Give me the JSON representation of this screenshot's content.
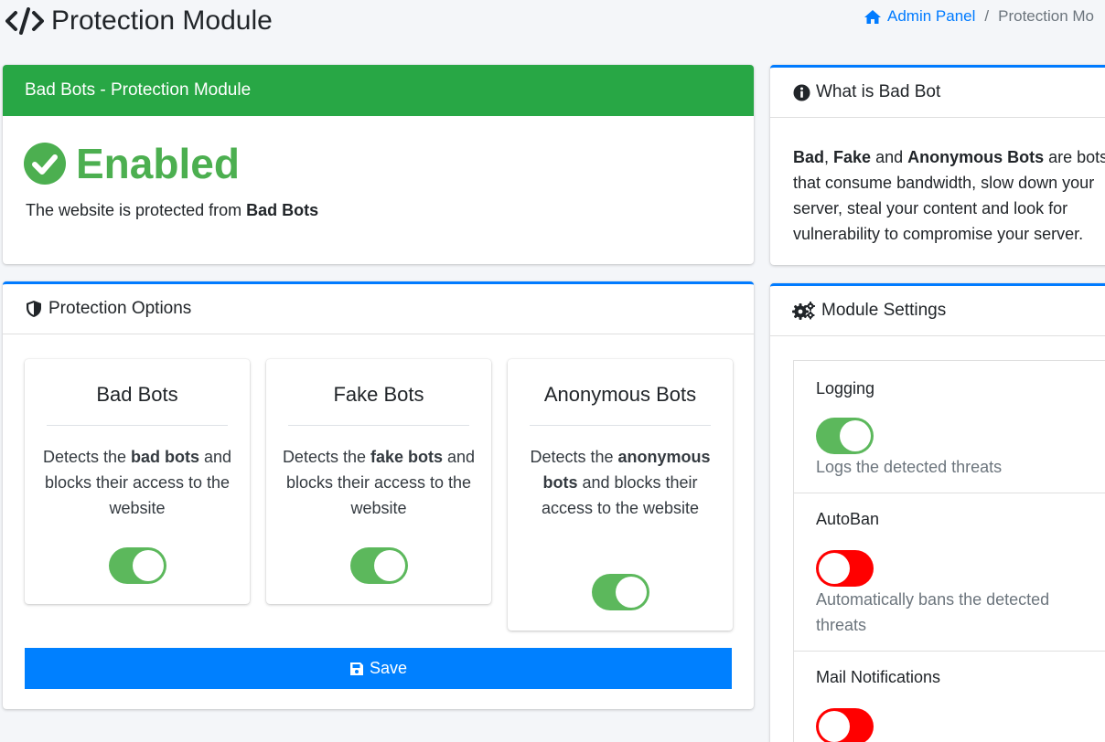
{
  "page": {
    "title": "Protection Module",
    "breadcrumb": {
      "home": "Admin Panel",
      "separator": "/",
      "current": "Protection Mo"
    }
  },
  "status_card": {
    "header": "Bad Bots - Protection Module",
    "status": "Enabled",
    "desc_prefix": "The website is protected from ",
    "desc_bold": "Bad Bots"
  },
  "options_card": {
    "header": "Protection Options",
    "options": [
      {
        "title": "Bad Bots",
        "d1": "Detects the ",
        "bold": "bad bots",
        "d2": " and blocks their access to the website",
        "enabled": true
      },
      {
        "title": "Fake Bots",
        "d1": "Detects the ",
        "bold": "fake bots",
        "d2": " and blocks their access to the website",
        "enabled": true
      },
      {
        "title": "Anonymous Bots",
        "d1": "Detects the ",
        "bold": "anonymous bots",
        "d2": " and blocks their access to the website",
        "enabled": true
      }
    ],
    "save_label": "Save"
  },
  "info_card": {
    "header": "What is Bad Bot",
    "b1": "Bad",
    "t1": ", ",
    "b2": "Fake",
    "t2": " and ",
    "b3": "Anonymous Bots",
    "t3": " are bots that consume bandwidth, slow down your server, steal your content and look for vulnerability to compromise your server."
  },
  "settings_card": {
    "header": "Module Settings",
    "settings": [
      {
        "label": "Logging",
        "desc": "Logs the detected threats",
        "enabled": true
      },
      {
        "label": "AutoBan",
        "desc": "Automatically bans the detected threats",
        "enabled": false
      },
      {
        "label": "Mail Notifications",
        "desc": "",
        "enabled": false
      }
    ]
  },
  "colors": {
    "success": "#28a745",
    "primary": "#007bff",
    "save": "#0080ff",
    "toggle_on": "#5cb85c",
    "toggle_off": "#ff0000"
  }
}
